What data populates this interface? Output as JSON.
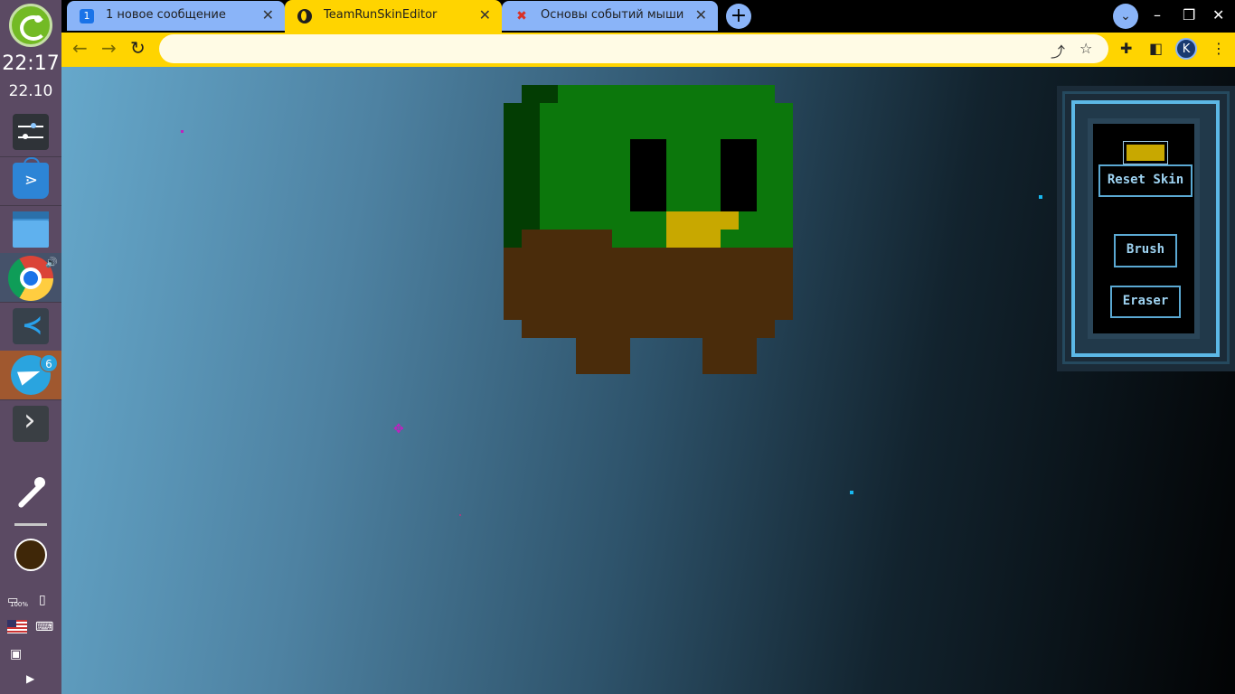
{
  "dock": {
    "time": "22:17",
    "date": "22.10",
    "apps": [
      {
        "name": "settings-app-icon"
      },
      {
        "name": "software-store-app-icon"
      },
      {
        "name": "files-app-icon"
      },
      {
        "name": "chrome-app-icon"
      },
      {
        "name": "vscode-app-icon"
      },
      {
        "name": "telegram-app-icon",
        "badge": "6"
      },
      {
        "name": "terminal-app-icon"
      }
    ],
    "picker_color": "#3f2708",
    "tray": {
      "battery": "100%"
    }
  },
  "browser": {
    "tabs": [
      {
        "title": "1 новое сообщение",
        "icon": "1"
      },
      {
        "title": "TeamRunSkinEditor",
        "icon": "globe-icon",
        "active": true
      },
      {
        "title": "Основы событий мыши",
        "icon": "figure-icon"
      }
    ],
    "address_value": "",
    "window_buttons": [
      "–",
      "❐",
      "✕"
    ],
    "theme_color": "#ffd400",
    "profile_initial": "K"
  },
  "skin_editor": {
    "current_color": "#c8a800",
    "buttons": {
      "reset": "Reset Skin",
      "brush": "Brush",
      "eraser": "Eraser"
    },
    "palette": {
      "dark_green": "#033d03",
      "green": "#0c770c",
      "black": "#000000",
      "yellow": "#c8a800",
      "brown": "#4a2c0b"
    },
    "pixel_grid": {
      "cell": 20,
      "rows": [
        "..111111111111..",
        ".1222222222222..",
        ".22222222222222.",
        ".2222733223332..",
        ".2222733223332..",
        ".22227332233322.",
        ".2222244442222..",
        ".222332222222....",
        ".55555555555555.",
        ".55555555555555.",
        "..555555555555..",
        ".....555..555...",
        ".....555..555..."
      ]
    }
  }
}
